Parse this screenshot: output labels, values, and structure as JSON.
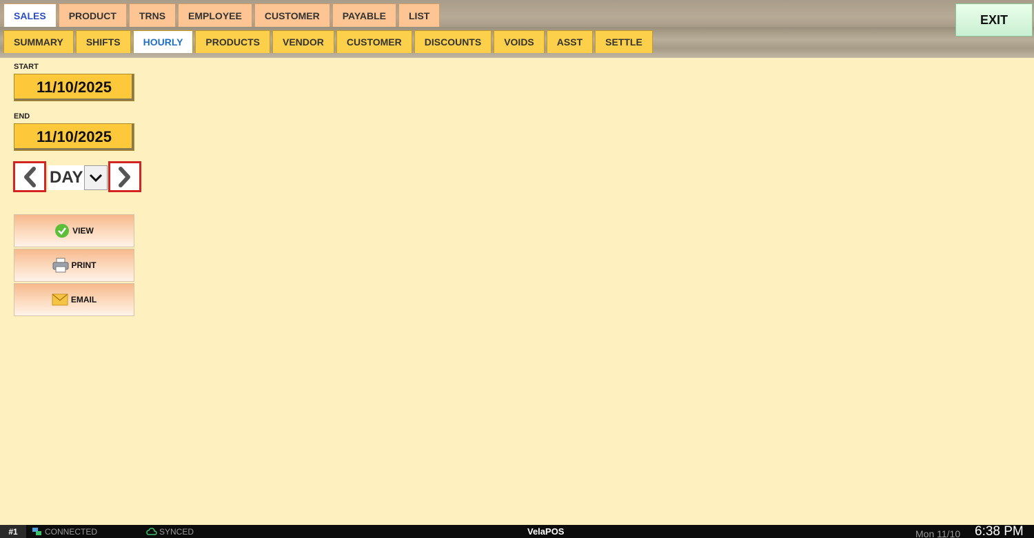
{
  "main_tabs": [
    {
      "label": "SALES",
      "active": true
    },
    {
      "label": "PRODUCT",
      "active": false
    },
    {
      "label": "TRNS",
      "active": false
    },
    {
      "label": "EMPLOYEE",
      "active": false
    },
    {
      "label": "CUSTOMER",
      "active": false
    },
    {
      "label": "PAYABLE",
      "active": false
    },
    {
      "label": "LIST",
      "active": false
    }
  ],
  "sub_tabs": [
    {
      "label": "SUMMARY",
      "active": false
    },
    {
      "label": "SHIFTS",
      "active": false
    },
    {
      "label": "HOURLY",
      "active": true
    },
    {
      "label": "PRODUCTS",
      "active": false
    },
    {
      "label": "VENDOR",
      "active": false
    },
    {
      "label": "CUSTOMER",
      "active": false
    },
    {
      "label": "DISCOUNTS",
      "active": false
    },
    {
      "label": "VOIDS",
      "active": false
    },
    {
      "label": "ASST",
      "active": false
    },
    {
      "label": "SETTLE",
      "active": false
    }
  ],
  "exit_label": "EXIT",
  "filters": {
    "start_label": "START",
    "start_date": "11/10/2025",
    "end_label": "END",
    "end_date": "11/10/2025",
    "period": "DAY",
    "prev_icon": "chevron-left-icon",
    "next_icon": "chevron-right-icon"
  },
  "actions": [
    {
      "label": "VIEW",
      "icon": "check-circle-icon"
    },
    {
      "label": "PRINT",
      "icon": "printer-icon"
    },
    {
      "label": "EMAIL",
      "icon": "envelope-icon"
    }
  ],
  "status": {
    "terminal": "#1",
    "connection": "CONNECTED",
    "sync": "SYNCED",
    "brand": "VelaPOS",
    "date": "Mon 11/10",
    "time": "6:38 PM"
  },
  "colors": {
    "background": "#fff0c0",
    "main_tab": "#fcc593",
    "sub_tab": "#fcd04a",
    "date_field": "#fdc93a",
    "arrow_border": "#d32323",
    "exit": "#d8f5dd"
  }
}
